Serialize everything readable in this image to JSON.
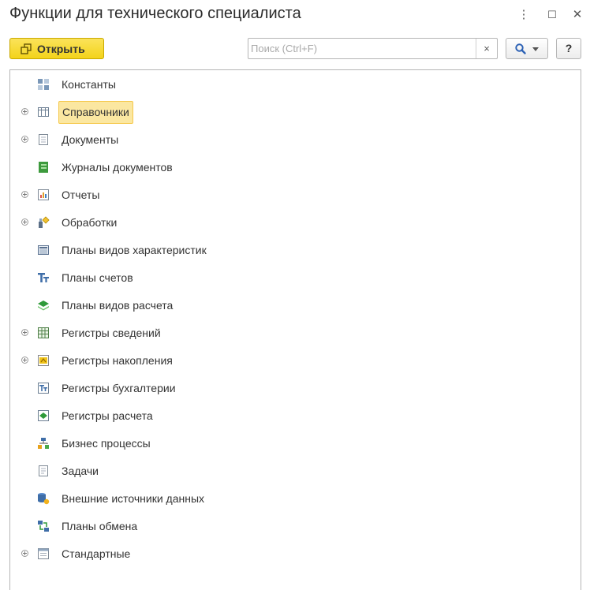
{
  "window": {
    "title": "Функции для технического специалиста",
    "menu_glyph": "⋮",
    "maximize_glyph": "☐",
    "close_glyph": "✕"
  },
  "toolbar": {
    "open_label": "Открыть",
    "search_placeholder": "Поиск (Ctrl+F)",
    "search_value": "",
    "clear_glyph": "×",
    "help_label": "?"
  },
  "colors": {
    "accent_yellow": "#f3d31a",
    "selection_fill": "#fbe7a1",
    "selection_border": "#f5c84b"
  },
  "tree": {
    "selected_index": 1,
    "items": [
      {
        "label": "Константы",
        "icon": "constants-icon",
        "expandable": false
      },
      {
        "label": "Справочники",
        "icon": "catalogs-icon",
        "expandable": true
      },
      {
        "label": "Документы",
        "icon": "documents-icon",
        "expandable": true
      },
      {
        "label": "Журналы документов",
        "icon": "document-journals-icon",
        "expandable": false
      },
      {
        "label": "Отчеты",
        "icon": "reports-icon",
        "expandable": true
      },
      {
        "label": "Обработки",
        "icon": "data-processors-icon",
        "expandable": true
      },
      {
        "label": "Планы видов характеристик",
        "icon": "chart-of-characteristic-types-icon",
        "expandable": false
      },
      {
        "label": "Планы счетов",
        "icon": "chart-of-accounts-icon",
        "expandable": false
      },
      {
        "label": "Планы видов расчета",
        "icon": "chart-of-calculation-types-icon",
        "expandable": false
      },
      {
        "label": "Регистры сведений",
        "icon": "information-registers-icon",
        "expandable": true
      },
      {
        "label": "Регистры накопления",
        "icon": "accumulation-registers-icon",
        "expandable": true
      },
      {
        "label": "Регистры бухгалтерии",
        "icon": "accounting-registers-icon",
        "expandable": false
      },
      {
        "label": "Регистры расчета",
        "icon": "calculation-registers-icon",
        "expandable": false
      },
      {
        "label": "Бизнес процессы",
        "icon": "business-processes-icon",
        "expandable": false
      },
      {
        "label": "Задачи",
        "icon": "tasks-icon",
        "expandable": false
      },
      {
        "label": "Внешние источники данных",
        "icon": "external-data-sources-icon",
        "expandable": false
      },
      {
        "label": "Планы обмена",
        "icon": "exchange-plans-icon",
        "expandable": false
      },
      {
        "label": "Стандартные",
        "icon": "standard-icon",
        "expandable": true
      }
    ]
  }
}
